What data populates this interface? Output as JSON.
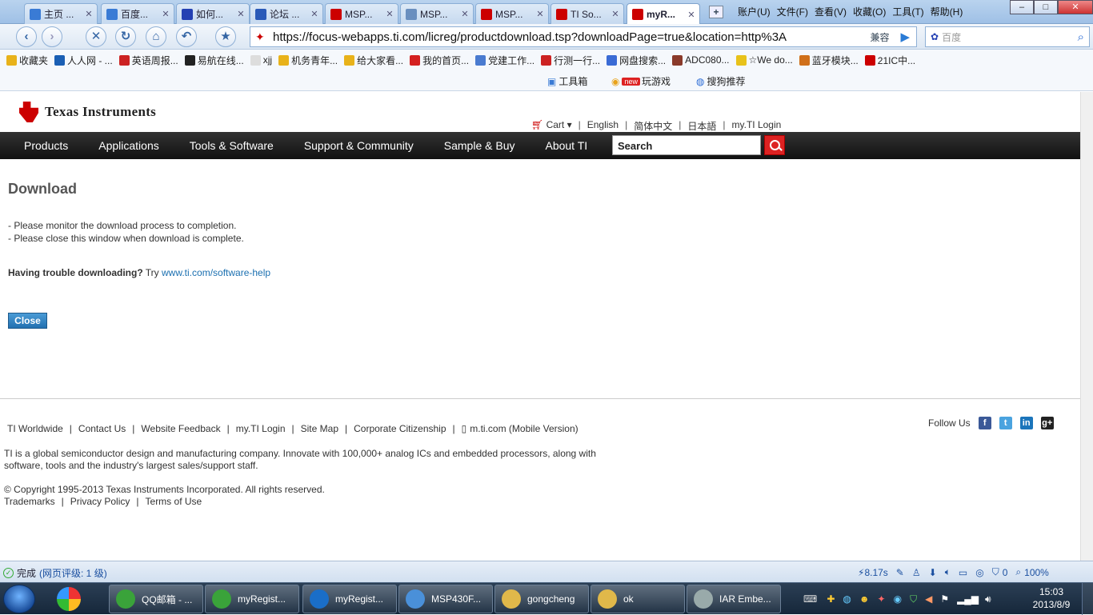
{
  "tabs": [
    {
      "label": "主页 ...",
      "icon": "home-icon",
      "color": "#3a7bd5"
    },
    {
      "label": "百度...",
      "icon": "translate-icon",
      "color": "#3a7bd5"
    },
    {
      "label": "如何...",
      "icon": "baidu-paw-icon",
      "color": "#2440b3"
    },
    {
      "label": "论坛 ...",
      "icon": "forum-icon",
      "color": "#2a5ab8"
    },
    {
      "label": "MSP...",
      "icon": "ti-logo-icon",
      "color": "#cc0000"
    },
    {
      "label": "MSP...",
      "icon": "document-icon",
      "color": "#6a8fbf"
    },
    {
      "label": "MSP...",
      "icon": "ti-logo-icon",
      "color": "#cc0000"
    },
    {
      "label": "TI So...",
      "icon": "ti-logo-icon",
      "color": "#cc0000"
    },
    {
      "label": "myR...",
      "icon": "ti-logo-icon",
      "color": "#cc0000",
      "active": true
    }
  ],
  "menubar": [
    "账户(U)",
    "文件(F)",
    "查看(V)",
    "收藏(O)",
    "工具(T)",
    "帮助(H)"
  ],
  "url": "https://focus-webapps.ti.com/licreg/productdownload.tsp?downloadPage=true&location=http%3A",
  "compat_label": "兼容",
  "search_placeholder": "百度",
  "favorites": [
    {
      "label": "收藏夹",
      "color": "#e8b21a"
    },
    {
      "label": "人人网 - ...",
      "color": "#1a5fb4"
    },
    {
      "label": "英语周报...",
      "color": "#cc2222"
    },
    {
      "label": "易航在线...",
      "color": "#222222"
    },
    {
      "label": "xjj",
      "color": "#dddddd"
    },
    {
      "label": "机务青年...",
      "color": "#e8b21a"
    },
    {
      "label": "给大家看...",
      "color": "#e8b21a"
    },
    {
      "label": "我的首页...",
      "color": "#d42020"
    },
    {
      "label": "党建工作...",
      "color": "#4a7bd0"
    },
    {
      "label": "行测一行...",
      "color": "#cc2222"
    },
    {
      "label": "网盘搜索...",
      "color": "#3a6bd5"
    },
    {
      "label": "ADC080...",
      "color": "#8a3a2a"
    },
    {
      "label": "☆We do...",
      "color": "#e8c21a"
    },
    {
      "label": "蓝牙模块...",
      "color": "#d0701a"
    },
    {
      "label": "21IC中...",
      "color": "#cc0000"
    }
  ],
  "tools": [
    {
      "label": "工具箱",
      "icon": "toolbox-icon"
    },
    {
      "label": "玩游戏",
      "badge": "new",
      "icon": "game-icon"
    },
    {
      "label": "搜狗推荐",
      "icon": "sogou-icon"
    }
  ],
  "site": {
    "logo_text": "Texas Instruments",
    "util_nav": [
      "Cart",
      "English",
      "简体中文",
      "日本語",
      "my.TI Login"
    ],
    "main_nav": [
      "Products",
      "Applications",
      "Tools & Software",
      "Support & Community",
      "Sample & Buy",
      "About TI"
    ],
    "search_label": "Search"
  },
  "content": {
    "title": "Download",
    "messages": [
      "- Please monitor the download process to completion.",
      "- Please close this window when download is complete."
    ],
    "trouble_bold": "Having trouble downloading?",
    "trouble_text": "Try",
    "trouble_link": "www.ti.com/software-help",
    "close_label": "Close"
  },
  "footer": {
    "links": [
      "TI Worldwide",
      "Contact Us",
      "Website Feedback",
      "my.TI Login",
      "Site Map",
      "Corporate Citizenship",
      "m.ti.com (Mobile Version)"
    ],
    "follow_label": "Follow Us",
    "social": [
      {
        "icon": "facebook-icon",
        "glyph": "f",
        "color": "#3b5998"
      },
      {
        "icon": "twitter-icon",
        "glyph": "t",
        "color": "#4aa3df"
      },
      {
        "icon": "linkedin-icon",
        "glyph": "in",
        "color": "#1b75bb"
      },
      {
        "icon": "googleplus-icon",
        "glyph": "g+",
        "color": "#222222"
      }
    ],
    "about": "TI is a global semiconductor design and manufacturing company. Innovate with 100,000+ analog ICs and embedded processors, along with software, tools and the industry's largest sales/support staff.",
    "copyright": "© Copyright 1995-2013  Texas Instruments Incorporated. All rights reserved.",
    "legal": [
      "Trademarks",
      "Privacy Policy",
      "Terms of Use"
    ]
  },
  "status": {
    "done": "完成",
    "rank": "(网页评级: 1 级)",
    "load_time": "8.17s",
    "count": "0",
    "zoom": "100%"
  },
  "taskbar": {
    "tasks": [
      {
        "label": "QQ邮箱 - ...",
        "color": "#3aa33a"
      },
      {
        "label": "myRegist...",
        "color": "#3aa33a"
      },
      {
        "label": "myRegist...",
        "color": "#1a6ec8"
      },
      {
        "label": "MSP430F...",
        "color": "#4a90d9"
      },
      {
        "label": "gongcheng",
        "color": "#e0b84a"
      },
      {
        "label": "ok",
        "color": "#e0b84a"
      },
      {
        "label": "IAR Embe...",
        "color": "#9aa"
      }
    ],
    "time": "15:03",
    "date": "2013/8/9"
  }
}
